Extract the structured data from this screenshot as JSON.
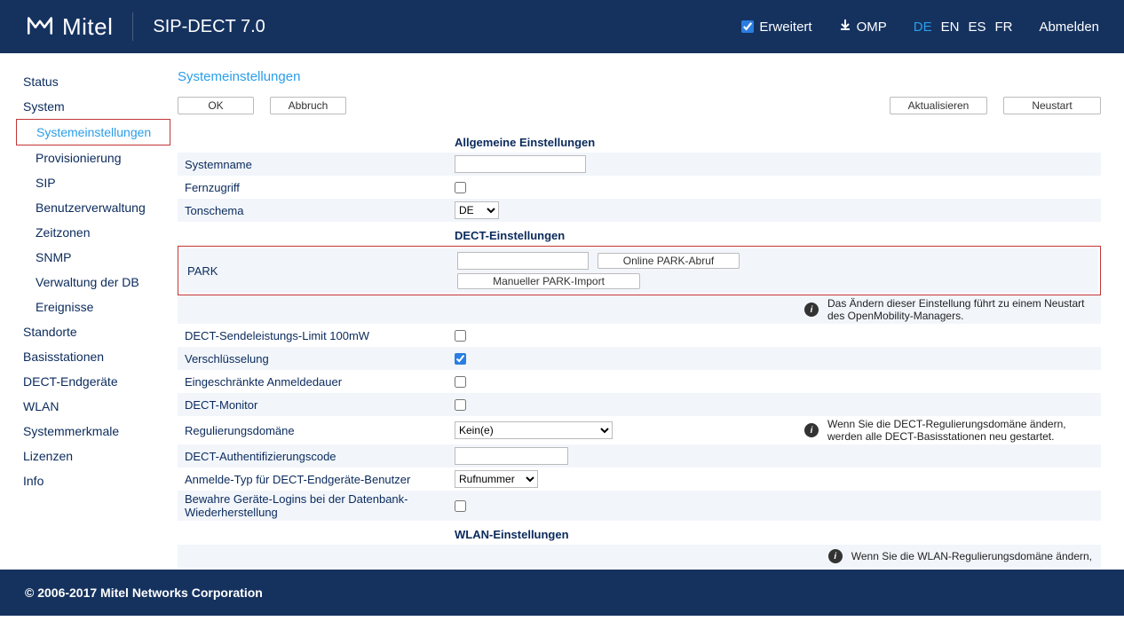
{
  "header": {
    "brand": "Mitel",
    "app_title": "SIP-DECT 7.0",
    "advanced_label": "Erweitert",
    "omp_label": "OMP",
    "languages": [
      "DE",
      "EN",
      "ES",
      "FR"
    ],
    "active_lang": "DE",
    "logout": "Abmelden"
  },
  "sidebar": {
    "items": [
      {
        "label": "Status"
      },
      {
        "label": "System"
      },
      {
        "label": "Systemeinstellungen",
        "sub": true,
        "active": true,
        "highlight": true
      },
      {
        "label": "Provisionierung",
        "sub": true
      },
      {
        "label": "SIP",
        "sub": true
      },
      {
        "label": "Benutzerverwaltung",
        "sub": true
      },
      {
        "label": "Zeitzonen",
        "sub": true
      },
      {
        "label": "SNMP",
        "sub": true
      },
      {
        "label": "Verwaltung der DB",
        "sub": true
      },
      {
        "label": "Ereignisse",
        "sub": true
      },
      {
        "label": "Standorte"
      },
      {
        "label": "Basisstationen"
      },
      {
        "label": "DECT-Endgeräte"
      },
      {
        "label": "WLAN"
      },
      {
        "label": "Systemmerkmale"
      },
      {
        "label": "Lizenzen"
      },
      {
        "label": "Info"
      }
    ]
  },
  "page": {
    "title": "Systemeinstellungen",
    "buttons": {
      "ok": "OK",
      "cancel": "Abbruch",
      "refresh": "Aktualisieren",
      "restart": "Neustart"
    },
    "sections": {
      "general": "Allgemeine Einstellungen",
      "dect": "DECT-Einstellungen",
      "wlan": "WLAN-Einstellungen"
    },
    "general": {
      "system_name": "Systemname",
      "remote_access": "Fernzugriff",
      "tone_scheme": "Tonschema",
      "tone_value": "DE"
    },
    "dect": {
      "park_label": "PARK",
      "park_online": "Online PARK-Abruf",
      "park_manual": "Manueller PARK-Import",
      "park_info": "Das Ändern dieser Einstellung führt zu einem Neustart des OpenMobility-Managers.",
      "tx_limit": "DECT-Sendeleistungs-Limit 100mW",
      "encryption": "Verschlüsselung",
      "restricted_sub": "Eingeschränkte Anmeldedauer",
      "dect_monitor": "DECT-Monitor",
      "reg_domain": "Regulierungsdomäne",
      "reg_domain_value": "Kein(e)",
      "reg_domain_info": "Wenn Sie die DECT-Regulierungsdomäne ändern, werden alle DECT-Basisstationen neu gestartet.",
      "auth_code": "DECT-Authentifizierungscode",
      "login_type": "Anmelde-Typ für DECT-Endgeräte-Benutzer",
      "login_type_value": "Rufnummer",
      "preserve_logins": "Bewahre Geräte-Logins bei der Datenbank-Wiederherstellung"
    },
    "wlan": {
      "info": "Wenn Sie die WLAN-Regulierungsdomäne ändern,"
    }
  },
  "footer": "© 2006-2017 Mitel Networks Corporation"
}
